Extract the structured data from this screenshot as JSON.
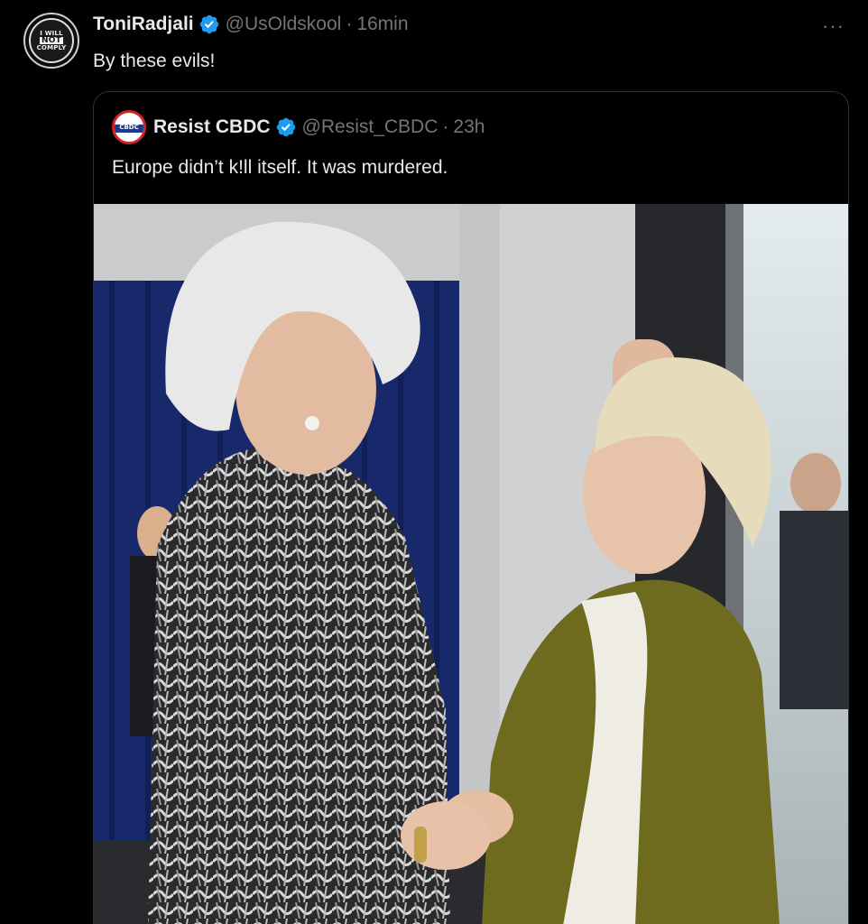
{
  "tweet": {
    "display_name": "ToniRadjali",
    "handle": "@UsOldskool",
    "separator": "·",
    "time": "16min",
    "text": "By these evils!",
    "more_label": "···",
    "avatar_text": [
      "I WILL",
      "NOT",
      "COMPLY"
    ]
  },
  "quoted": {
    "display_name": "Resist CBDC",
    "handle": "@Resist_CBDC",
    "separator": "·",
    "time": "23h",
    "text": "Europe didn’t k!ll itself. It was murdered.",
    "avatar_text": "CBDC",
    "image_icon": "photo-two-women-greeting"
  },
  "colors": {
    "background": "#000000",
    "text_primary": "#e7e9ea",
    "text_secondary": "#71767b",
    "verified": "#1d9bf0",
    "border": "#2f3336"
  }
}
